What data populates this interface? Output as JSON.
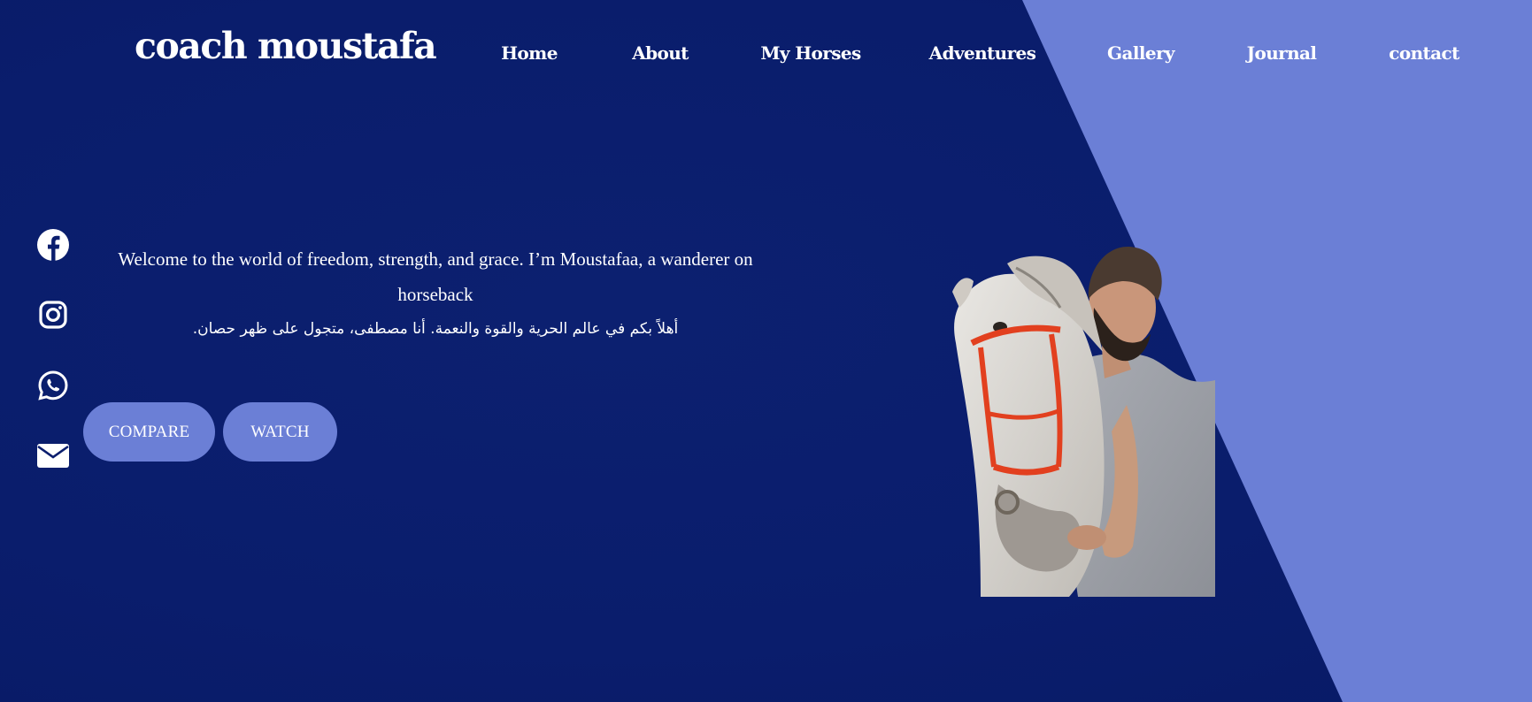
{
  "brand": {
    "name": "coach moustafa"
  },
  "nav": {
    "items": [
      {
        "label": "Home"
      },
      {
        "label": "About"
      },
      {
        "label": "My Horses"
      },
      {
        "label": "Adventures"
      },
      {
        "label": "Gallery"
      },
      {
        "label": "Journal"
      },
      {
        "label": "contact"
      }
    ]
  },
  "social": {
    "icons": [
      "facebook-icon",
      "instagram-icon",
      "whatsapp-icon",
      "envelope-icon"
    ]
  },
  "hero": {
    "line1": "Welcome to the world of freedom, strength, and grace. I’m Moustafaa, a wanderer on horseback",
    "line2_arabic": "أهلاً بكم في عالم الحرية والقوة والنعمة. أنا مصطفى، متجول على ظهر حصان."
  },
  "buttons": {
    "compare": "COMPARE",
    "watch": "WATCH"
  },
  "colors": {
    "background": "#0b1e6e",
    "accent_panel": "#6b7fd6",
    "button": "#6b7fd6",
    "text": "#ffffff"
  }
}
